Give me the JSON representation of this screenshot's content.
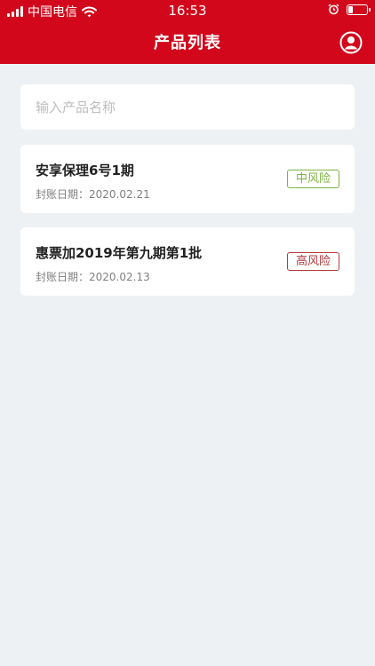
{
  "status_bar": {
    "carrier": "中国电信",
    "time": "16:53"
  },
  "header": {
    "title": "产品列表"
  },
  "search": {
    "placeholder": "输入产品名称",
    "value": ""
  },
  "products": [
    {
      "name": "安享保理6号1期",
      "date_label": "封账日期：",
      "date": "2020.02.21",
      "risk": "中风险",
      "risk_color": "#7cb342"
    },
    {
      "name": "惠票加2019年第九期第1批",
      "date_label": "封账日期：",
      "date": "2020.02.13",
      "risk": "高风险",
      "risk_color": "#b23a40"
    }
  ],
  "colors": {
    "brand": "#d2071b",
    "background": "#eef1f4"
  }
}
